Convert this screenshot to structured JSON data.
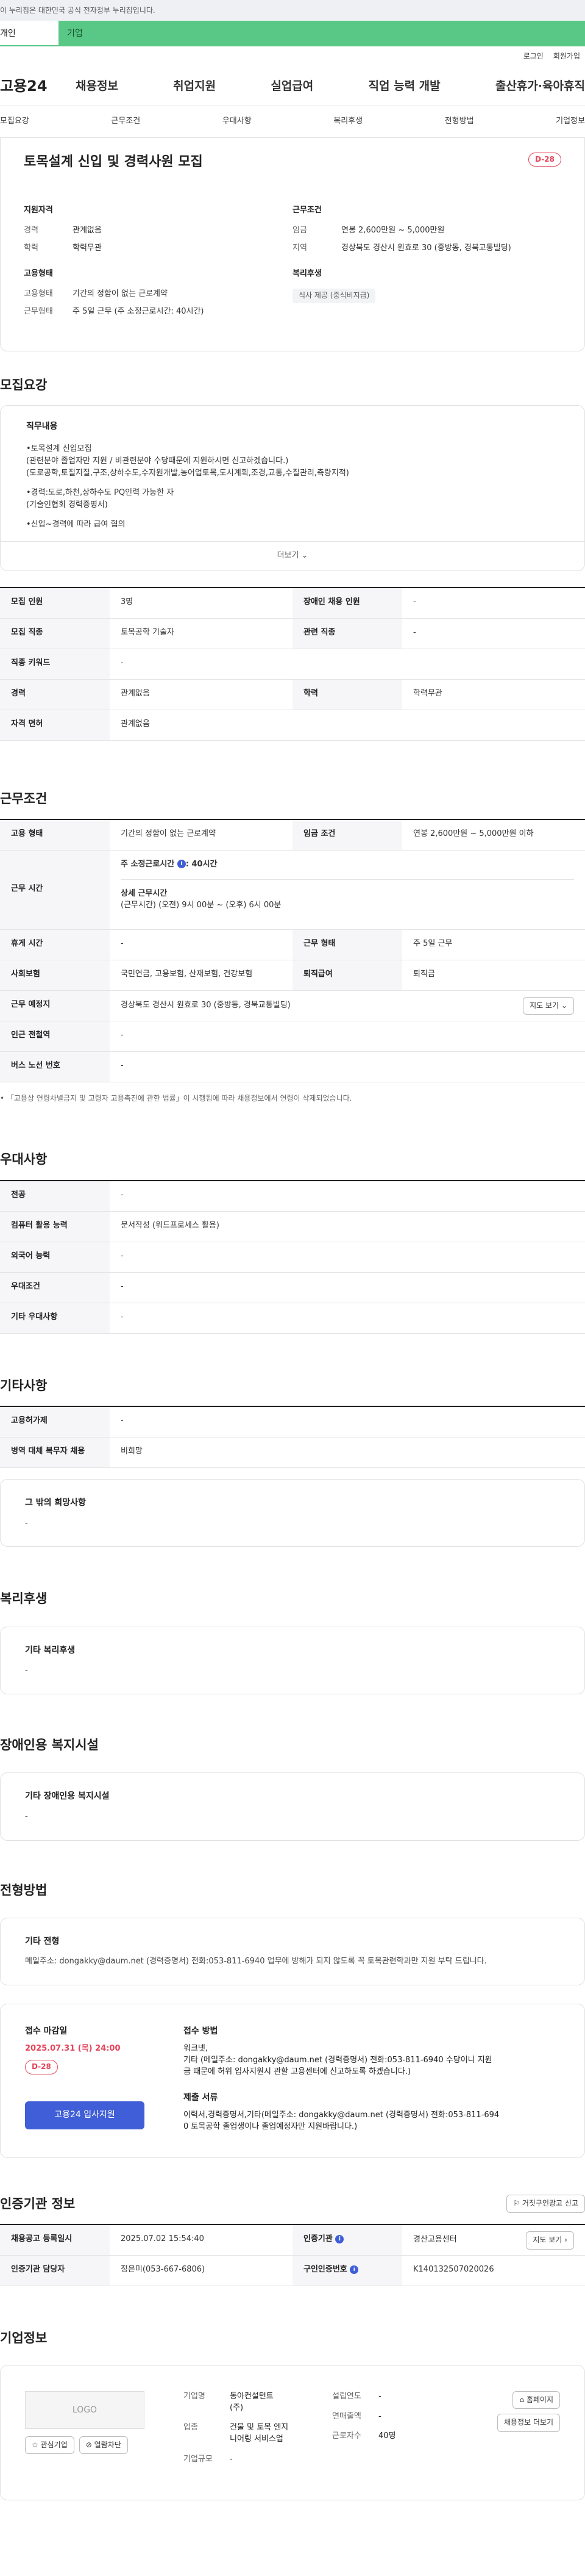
{
  "banner": {
    "text": "이 누리집은 대한민국 공식 전자정부 누리집입니다."
  },
  "site_tabs": [
    "개인",
    "기업"
  ],
  "top_links": [
    "로그인",
    "회원가입"
  ],
  "gnb": {
    "logo": "고용24",
    "menus": [
      "채용정보",
      "취업지원",
      "실업급여",
      "직업 능력 개발",
      "출산휴가·육아휴직"
    ]
  },
  "subnav": [
    "모집요강",
    "근무조건",
    "우대사항",
    "복리후생",
    "전형방법",
    "기업정보"
  ],
  "header": {
    "title": "토목설계 신입 및 경력사원 모집",
    "dday": "D-28",
    "qual": {
      "heading": "지원자격",
      "rows": [
        {
          "k": "경력",
          "v": "관계없음"
        },
        {
          "k": "학력",
          "v": "학력무관"
        }
      ]
    },
    "cond": {
      "heading": "근무조건",
      "rows": [
        {
          "k": "임금",
          "v": "연봉 2,600만원 ~ 5,000만원"
        },
        {
          "k": "지역",
          "v": "경상북도 경산시 원효로 30 (중방동, 경북교통빌딩)"
        }
      ]
    },
    "emp": {
      "heading": "고용형태",
      "rows": [
        {
          "k": "고용형태",
          "v": "기간의 정함이 없는 근로계약"
        },
        {
          "k": "근무형태",
          "v": "주 5일 근무 (주 소정근로시간: 40시간)"
        }
      ]
    },
    "welfare": {
      "heading": "복리후생",
      "chip": "식사 제공 (중식비지급)"
    }
  },
  "recruit": {
    "title": "모집요강",
    "duty_heading": "직무내용",
    "duty_lines": [
      "•토목설계 신입모집",
      " (관련분야 졸업자만 지원 /  비관련분야 수당때문에 지원하시면 신고하겠습니다.)",
      "(도로공학,토질지질,구조,상하수도,수자원개발,농어업토목,도시계획,조경,교통,수질관리,측량지적)",
      "",
      "•경력:도로,하천,상하수도 PQ인력 가능한 자",
      " (기술인협회 경력증명서)",
      "",
      "•신입~경력에 따라 급여 협의"
    ],
    "more": "더보기",
    "rows": [
      {
        "k1": "모집 인원",
        "v1": "3명",
        "k2": "장애인 채용 인원",
        "v2": "-"
      },
      {
        "k1": "모집 직종",
        "v1": "토목공학 기술자",
        "k2": "관련 직종",
        "v2": "-"
      },
      {
        "k1": "직종 키워드",
        "v1": "-"
      },
      {
        "k1": "경력",
        "v1": "관계없음",
        "k2": "학력",
        "v2": "학력무관"
      },
      {
        "k1": "자격 면허",
        "v1": "관계없음"
      }
    ]
  },
  "work": {
    "title": "근무조건",
    "emp_type_k": "고용 형태",
    "emp_type_v": "기간의 정함이 없는 근로계약",
    "pay_k": "임금 조건",
    "pay_v": "연봉 2,600만원 ~ 5,000만원 이하",
    "time_k": "근무 시간",
    "time_main": "주 소정근로시간",
    "time_hours": ": 40시간",
    "time_detail_h": "상세 근무시간",
    "time_detail": "(근무시간) (오전) 9시 00분 ~ (오후) 6시 00분",
    "rest_k": "휴게 시간",
    "rest_v": "-",
    "form_k": "근무 형태",
    "form_v": "주 5일 근무",
    "ins_k": "사회보험",
    "ins_v": "국민연금, 고용보험, 산재보험, 건강보험",
    "ret_k": "퇴직급여",
    "ret_v": "퇴직금",
    "place_k": "근무 예정지",
    "place_v": "경상북도 경산시 원효로 30 (중방동, 경북교통빌딩)",
    "map_btn": "지도 보기",
    "subway_k": "인근 전철역",
    "subway_v": "-",
    "bus_k": "버스 노선 번호",
    "bus_v": "-",
    "note": "• 「고용상 연령차별금지 및 고령자 고용촉진에 관한 법률」이 시행됨에 따라 채용정보에서 연령이 삭제되었습니다."
  },
  "pref": {
    "title": "우대사항",
    "rows": [
      {
        "k": "전공",
        "v": "-"
      },
      {
        "k": "컴퓨터 활용 능력",
        "v": "문서작성 (워드프로세스 활용)"
      },
      {
        "k": "외국어 능력",
        "v": "-"
      },
      {
        "k": "우대조건",
        "v": "-"
      },
      {
        "k": "기타 우대사항",
        "v": "-"
      }
    ]
  },
  "etc": {
    "title": "기타사항",
    "rows": [
      {
        "k": "고용허가제",
        "v": "-"
      },
      {
        "k": "병역 대체 복무자 채용",
        "v": "비희망"
      }
    ],
    "card_h": "그 밖의 희망사항",
    "card_v": "-"
  },
  "welfare": {
    "title": "복리후생",
    "card_h": "기타 복리후생",
    "card_v": "-"
  },
  "disab": {
    "title": "장애인용 복지시설",
    "card_h": "기타 장애인용 복지시설",
    "card_v": "-"
  },
  "select": {
    "title": "전형방법",
    "card_h": "기타 전형",
    "card_v": "메일주소: dongakky@daum.net (경력증명서) 전화:053-811-6940 업무에 방해가 되지 않도록 꼭 토목관련학과만 지원 부탁 드립니다.",
    "deadline_h": "접수 마감일",
    "deadline": "2025.07.31 (목) 24:00",
    "dday": "D-28",
    "apply_btn": "고용24 입사지원",
    "method_h": "접수 방법",
    "method_1": "워크넷,",
    "method_2": "기타 (메일주소: dongakky@daum.net   (경력증명서) 전화:053-811-6940 수당이니 지원",
    "method_3": "금 때문에 허위 입사지원시 관할 고용센터에 신고하도록 하겠습니다.)",
    "docs_h": "제출 서류",
    "docs_1": "이력서,경력증명서,기타(메일주소: dongakky@daum.net (경력증명서) 전화:053-811-694",
    "docs_2": "0 토목공학 졸업생이나 졸업예정자만 지원바랍니다.)"
  },
  "agency": {
    "title": "인증기관 정보",
    "report_btn": "거짓구인광고 신고",
    "reg_k": "채용공고 등록일시",
    "reg_v": "2025.07.02 15:54:40",
    "org_k": "인증기관",
    "org_v": "경산고용센터",
    "map_btn": "지도 보기",
    "mgr_k": "인증기관 담당자",
    "mgr_v": "정은미(053-667-6806)",
    "no_k": "구인인증번호",
    "no_v": "K140132507020026"
  },
  "company": {
    "title": "기업정보",
    "logo": "LOGO",
    "fav_btn": "관심기업",
    "block_btn": "열람차단",
    "name_k": "기업명",
    "name_v1": "동아컨설턴트",
    "name_v2": "(주)",
    "year_k": "설립연도",
    "year_v": "-",
    "sales_k": "연매출액",
    "sales_v": "-",
    "ind_k": "업종",
    "ind_v1": "건물 및 토목 엔지",
    "ind_v2": "니어링 서비스업",
    "emp_k": "근로자수",
    "emp_v": "40명",
    "scale_k": "기업규모",
    "scale_v": "-",
    "home_btn": "홈페이지",
    "jobs_btn": "채용정보 더보기"
  }
}
